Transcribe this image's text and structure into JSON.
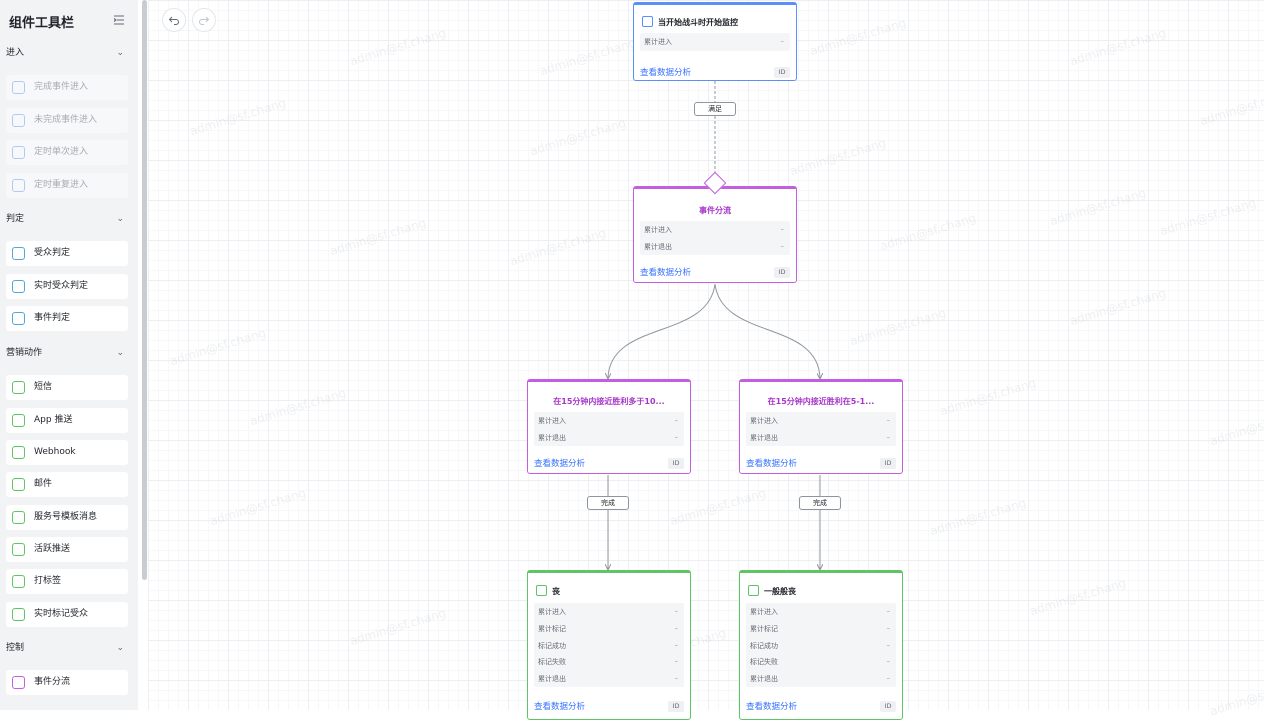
{
  "sidebar": {
    "title": "组件工具栏",
    "groups": [
      {
        "label": "进入",
        "items": [
          {
            "label": "完成事件进入",
            "icon": "event-enter-icon",
            "disabled": true
          },
          {
            "label": "未完成事件进入",
            "icon": "event-not-done-icon",
            "disabled": true
          },
          {
            "label": "定时单次进入",
            "icon": "timer-once-icon",
            "disabled": true
          },
          {
            "label": "定时重复进入",
            "icon": "timer-repeat-icon",
            "disabled": true
          }
        ]
      },
      {
        "label": "判定",
        "items": [
          {
            "label": "受众判定",
            "icon": "audience-icon"
          },
          {
            "label": "实时受众判定",
            "icon": "realtime-audience-icon"
          },
          {
            "label": "事件判定",
            "icon": "event-judge-icon"
          }
        ]
      },
      {
        "label": "营销动作",
        "items": [
          {
            "label": "短信",
            "icon": "send-icon"
          },
          {
            "label": "App 推送",
            "icon": "phone-icon"
          },
          {
            "label": "Webhook",
            "icon": "webhook-icon"
          },
          {
            "label": "邮件",
            "icon": "mail-icon"
          },
          {
            "label": "服务号模板消息",
            "icon": "wechat-icon"
          },
          {
            "label": "活跃推送",
            "icon": "wechat-icon"
          },
          {
            "label": "打标签",
            "icon": "tag-user-icon"
          },
          {
            "label": "实时标记受众",
            "icon": "realtime-tag-icon"
          }
        ]
      },
      {
        "label": "控制",
        "items": [
          {
            "label": "事件分流",
            "icon": "split-icon"
          }
        ]
      }
    ]
  },
  "colors": {
    "blue": "#5b8ff9",
    "purple": "#c45ee0",
    "green": "#5fc463",
    "link": "#3370ff"
  },
  "canvas": {
    "watermark": "admin@sf.chang",
    "nodes": {
      "start": {
        "title": "当开始战斗时开始监控",
        "metrics": [
          "累计进入"
        ],
        "analysis": "查看数据分析",
        "id": "ID"
      },
      "split": {
        "title": "事件分流",
        "metrics": [
          "累计进入",
          "累计退出"
        ],
        "analysis": "查看数据分析",
        "id": "ID"
      },
      "branch_left": {
        "title": "在15分钟内接近胜利多于10...",
        "metrics": [
          "累计进入",
          "累计退出"
        ],
        "analysis": "查看数据分析",
        "id": "ID"
      },
      "branch_right": {
        "title": "在15分钟内接近胜利在5-1...",
        "metrics": [
          "累计进入",
          "累计退出"
        ],
        "analysis": "查看数据分析",
        "id": "ID"
      },
      "action_left": {
        "title": "丧",
        "metrics": [
          "累计进入",
          "累计标记",
          "标记成功",
          "标记失败",
          "累计退出"
        ],
        "analysis": "查看数据分析",
        "id": "ID"
      },
      "action_right": {
        "title": "一般般丧",
        "metrics": [
          "累计进入",
          "累计标记",
          "标记成功",
          "标记失败",
          "累计退出"
        ],
        "analysis": "查看数据分析",
        "id": "ID"
      }
    },
    "dash": "–",
    "edges": {
      "satisfy": "满足",
      "done": "完成"
    }
  }
}
